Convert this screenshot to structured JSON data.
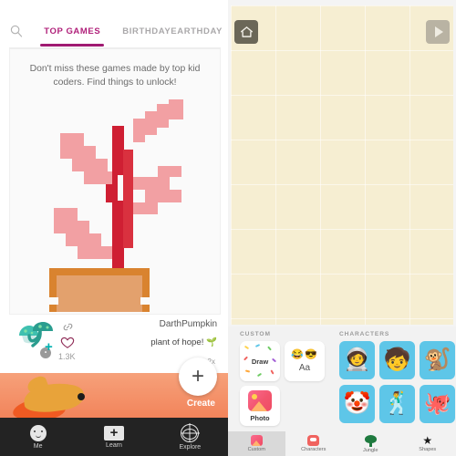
{
  "left_app": {
    "search_icon": "search-icon",
    "tabs": [
      {
        "label": "TOP GAMES",
        "active": true
      },
      {
        "label": "BIRTHDAYEARTHDAY",
        "active": false
      }
    ],
    "card": {
      "caption": "Don't miss these games made by top kid coders. Find things to unlock!",
      "artwork": {
        "name": "pixel-plant-artwork",
        "stem_color": "#cf1f33",
        "leaf_color": "#f2a0a3",
        "pot_color": "#e3a16d",
        "pot_edge_color": "#d9832f",
        "background": "#fafafa"
      }
    },
    "post": {
      "username": "DarthPumpkin",
      "caption": "plant of hope! 🌱",
      "like_count": "1.3K",
      "play_count": "2x",
      "avatar_icon": "mushroom-avatar-icon",
      "link_icon": "link-icon",
      "heart_icon": "heart-icon",
      "play_icon": "play-icon",
      "add_friend_icon": "add-friend-icon"
    },
    "fab": {
      "icon": "plus-icon",
      "label": "Create"
    },
    "promo": {
      "name": "goldfish-promo-banner",
      "color": "#f2845b"
    },
    "bottom_nav": [
      {
        "label": "Me",
        "icon": "face-icon"
      },
      {
        "label": "Learn",
        "icon": "plus-box-icon"
      },
      {
        "label": "Explore",
        "icon": "globe-icon"
      }
    ]
  },
  "right_editor": {
    "canvas": {
      "name": "project-canvas",
      "color": "#f6eed2",
      "grid": true
    },
    "home_button": {
      "icon": "home-icon"
    },
    "play_button": {
      "icon": "play-icon"
    },
    "sections": [
      {
        "title": "CUSTOM"
      },
      {
        "title": "CHARACTERS"
      }
    ],
    "custom_tiles": [
      {
        "label": "Draw",
        "icon": "confetti-draw-icon"
      },
      {
        "label": "Aa",
        "icon": "text-emoji-icon",
        "emojis": "😂😎"
      },
      {
        "label": "Photo",
        "icon": "photo-icon"
      }
    ],
    "characters": [
      {
        "name": "character-astronaut",
        "emoji": "🧑‍🚀"
      },
      {
        "name": "character-kid-hoodie",
        "emoji": "🧒"
      },
      {
        "name": "character-monkey",
        "emoji": "🐒"
      },
      {
        "name": "character-clown",
        "emoji": "🤡"
      },
      {
        "name": "character-robot-kid",
        "emoji": "🕺"
      },
      {
        "name": "character-octopus",
        "emoji": "🐙"
      }
    ],
    "palette_tabs": [
      {
        "label": "Custom",
        "icon": "photo-icon",
        "selected": true
      },
      {
        "label": "Characters",
        "icon": "character-icon",
        "selected": false
      },
      {
        "label": "Jungle",
        "icon": "tree-icon",
        "selected": false
      },
      {
        "label": "Shapes",
        "icon": "star-icon",
        "selected": false
      }
    ]
  }
}
